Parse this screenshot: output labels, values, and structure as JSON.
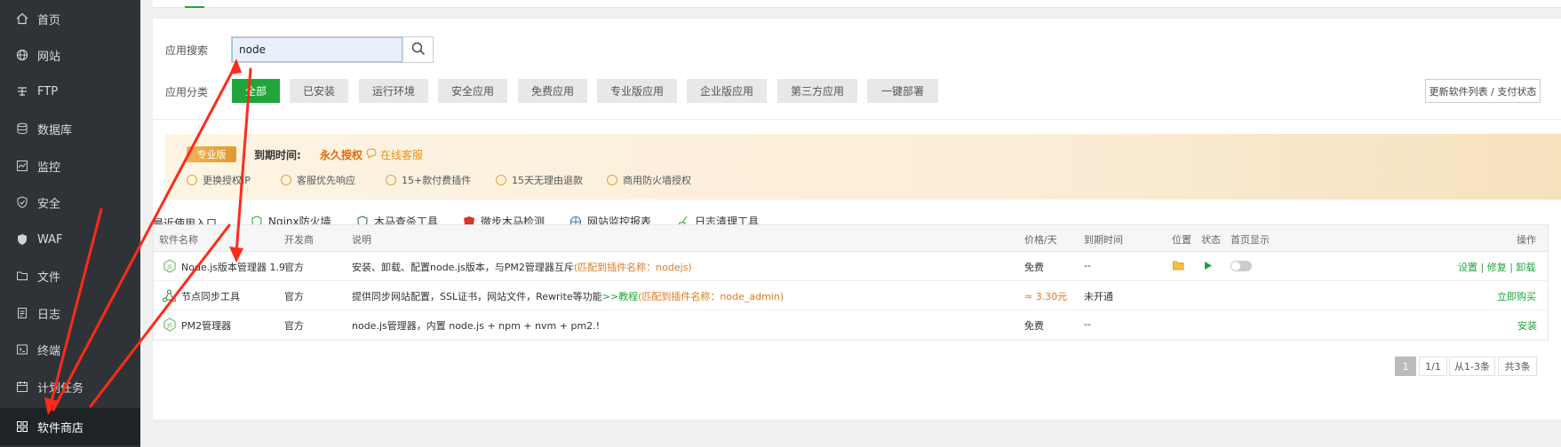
{
  "sidebar": {
    "items": [
      {
        "label": "首页",
        "icon": "home-icon"
      },
      {
        "label": "网站",
        "icon": "globe-icon"
      },
      {
        "label": "FTP",
        "icon": "ftp-icon"
      },
      {
        "label": "数据库",
        "icon": "database-icon"
      },
      {
        "label": "监控",
        "icon": "monitor-icon"
      },
      {
        "label": "安全",
        "icon": "shield-check-icon"
      },
      {
        "label": "WAF",
        "icon": "waf-shield-icon"
      },
      {
        "label": "文件",
        "icon": "folder-icon"
      },
      {
        "label": "日志",
        "icon": "log-icon"
      },
      {
        "label": "终端",
        "icon": "terminal-icon"
      },
      {
        "label": "计划任务",
        "icon": "calendar-icon"
      },
      {
        "label": "软件商店",
        "icon": "grid-icon",
        "active": true
      }
    ]
  },
  "search": {
    "label": "应用搜索",
    "value": "node"
  },
  "categories": {
    "label": "应用分类",
    "items": [
      "全部",
      "已安装",
      "运行环境",
      "安全应用",
      "免费应用",
      "专业版应用",
      "企业版应用",
      "第三方应用",
      "一键部署"
    ],
    "active_index": 0
  },
  "refresh_button": "更新软件列表 / 支付状态",
  "banner": {
    "badge": "专业版",
    "expire_label": "到期时间:",
    "expire_value": "永久授权",
    "support": "在线客服",
    "features": [
      "更换授权IP",
      "客服优先响应",
      "15+款付费插件",
      "15天无理由退款",
      "商用防火墙授权"
    ]
  },
  "recent": {
    "label": "最近使用入口",
    "tools": [
      "Nginx防火墙",
      "木马查杀工具",
      "微步木马检测",
      "网站监控报表",
      "日志清理工具"
    ]
  },
  "table": {
    "headers": {
      "name": "软件名称",
      "vendor": "开发商",
      "desc": "说明",
      "price": "价格/天",
      "expire": "到期时间",
      "location": "位置",
      "status": "状态",
      "homepage": "首页显示",
      "action": "操作"
    },
    "rows": [
      {
        "name": "Node.js版本管理器 1.9",
        "vendor": "官方",
        "desc": "安装、卸载、配置node.js版本，与PM2管理器互斥",
        "match": "(匹配到插件名称：nodejs)",
        "price": "免费",
        "expire": "--",
        "actions": "设置 | 修复 | 卸载"
      },
      {
        "name": "节点同步工具",
        "vendor": "官方",
        "desc": "提供同步网站配置，SSL证书，网站文件，Rewrite等功能",
        "link": ">>教程",
        "match": "(匹配到插件名称：node_admin)",
        "price": "≈ 3.30元",
        "expire": "未开通",
        "actions": "立即购买"
      },
      {
        "name": "PM2管理器",
        "vendor": "官方",
        "desc": "node.js管理器，内置 node.js + npm + nvm + pm2.!",
        "price": "免费",
        "expire": "--",
        "actions": "安装"
      }
    ]
  },
  "pagination": {
    "current": "1",
    "pages": "1/1",
    "range": "从1-3条",
    "total": "共3条"
  },
  "colors": {
    "accent": "#20a53a",
    "sidebar": "#2f3337",
    "annotation": "#ff2a1a"
  }
}
